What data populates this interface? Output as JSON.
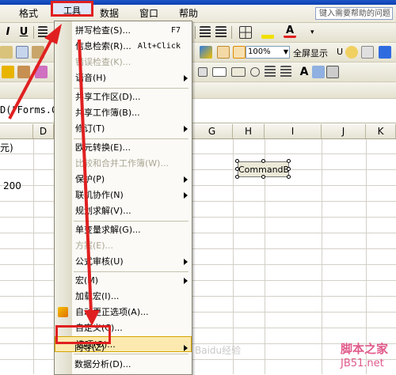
{
  "menubar": {
    "items_left": [
      "格式",
      "工具",
      "数据",
      "窗口",
      "帮助"
    ],
    "format_label": "格式",
    "tools_label": "工具",
    "data_label": "数据",
    "window_label": "窗口",
    "help_label": "帮助",
    "help_placeholder": "键入需要帮助的问题"
  },
  "toolbar": {
    "zoom": "100%",
    "fullscreen_label": "全屏显示",
    "fullscreen_key": "U"
  },
  "formula": {
    "content": "D(\"Forms.C"
  },
  "grid": {
    "columns": [
      "D",
      "G",
      "H",
      "I",
      "J",
      "K"
    ],
    "cell_a": "元)",
    "cell_b": "200"
  },
  "command_button": {
    "label": "CommandB"
  },
  "tools_menu": {
    "items": [
      {
        "label": "拼写检查(S)...",
        "key": "F7",
        "disabled": false,
        "submenu": false
      },
      {
        "label": "信息检索(R)...",
        "key": "Alt+Click",
        "disabled": false,
        "submenu": false
      },
      {
        "label": "错误检查(K)...",
        "key": "",
        "disabled": true,
        "submenu": false
      },
      {
        "label": "语音(H)",
        "key": "",
        "disabled": false,
        "submenu": true
      },
      {
        "label": "共享工作区(D)...",
        "key": "",
        "disabled": false,
        "submenu": false
      },
      {
        "label": "共享工作簿(B)...",
        "key": "",
        "disabled": false,
        "submenu": false
      },
      {
        "label": "修订(T)",
        "key": "",
        "disabled": false,
        "submenu": true
      },
      {
        "label": "欧元转换(E)...",
        "key": "",
        "disabled": false,
        "submenu": false
      },
      {
        "label": "比较和合并工作簿(W)...",
        "key": "",
        "disabled": true,
        "submenu": false
      },
      {
        "label": "保护(P)",
        "key": "",
        "disabled": false,
        "submenu": true
      },
      {
        "label": "联机协作(N)",
        "key": "",
        "disabled": false,
        "submenu": true
      },
      {
        "label": "规划求解(V)...",
        "key": "",
        "disabled": false,
        "submenu": false
      },
      {
        "label": "单变量求解(G)...",
        "key": "",
        "disabled": false,
        "submenu": false
      },
      {
        "label": "方案(E)...",
        "key": "",
        "disabled": true,
        "submenu": false
      },
      {
        "label": "公式审核(U)",
        "key": "",
        "disabled": false,
        "submenu": true
      },
      {
        "label": "宏(M)",
        "key": "",
        "disabled": false,
        "submenu": true
      },
      {
        "label": "加载宏(I)...",
        "key": "",
        "disabled": false,
        "submenu": false
      },
      {
        "label": "自动更正选项(A)...",
        "key": "",
        "disabled": false,
        "submenu": false
      },
      {
        "label": "自定义(C)...",
        "key": "",
        "disabled": false,
        "submenu": false
      },
      {
        "label": "选项(O)...",
        "key": "",
        "disabled": false,
        "submenu": false
      },
      {
        "label": "向导(Z)",
        "key": "",
        "disabled": false,
        "submenu": true
      },
      {
        "label": "数据分析(D)...",
        "key": "",
        "disabled": false,
        "submenu": false
      }
    ]
  },
  "watermark": {
    "line1": "脚本之家",
    "line2": "JB51.net",
    "faint": "Baidu经验"
  },
  "colors": {
    "highlight_red": "#e02020",
    "menu_hover": "#fbe9b0"
  }
}
